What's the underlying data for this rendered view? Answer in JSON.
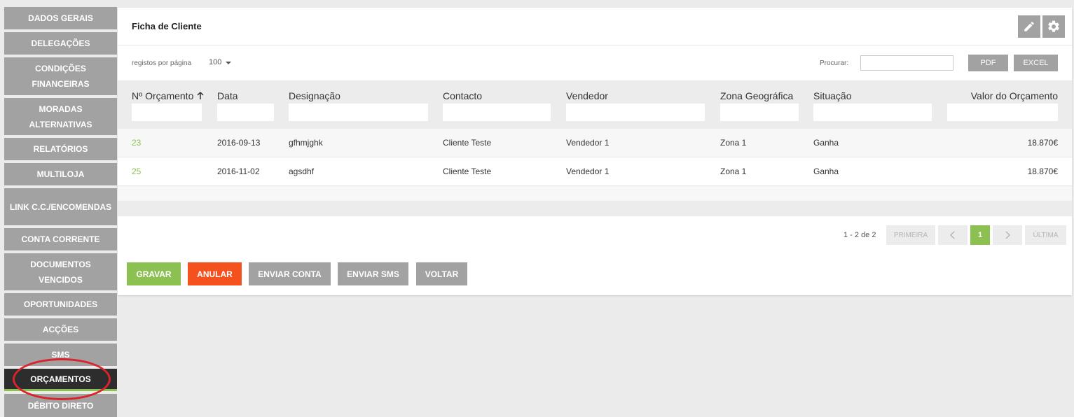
{
  "sidebar": {
    "items": [
      {
        "label": "DADOS GERAIS"
      },
      {
        "label": "DELEGAÇÕES"
      },
      {
        "label": "CONDIÇÕES FINANCEIRAS"
      },
      {
        "label": "MORADAS ALTERNATIVAS"
      },
      {
        "label": "RELATÓRIOS"
      },
      {
        "label": "MULTILOJA"
      },
      {
        "label": "LINK C.C./ENCOMENDAS"
      },
      {
        "label": "CONTA CORRENTE"
      },
      {
        "label": "DOCUMENTOS VENCIDOS"
      },
      {
        "label": "OPORTUNIDADES"
      },
      {
        "label": "ACÇÕES"
      },
      {
        "label": "SMS"
      },
      {
        "label": "ORÇAMENTOS"
      },
      {
        "label": "DÉBITO DIRETO"
      }
    ],
    "active_index": 12
  },
  "panel": {
    "title": "Ficha de Cliente",
    "icons": {
      "edit": "pencil-icon",
      "settings": "gear-icon"
    }
  },
  "toolbar": {
    "perpage_label": "registos por página",
    "perpage_value": "100",
    "search_label": "Procurar:",
    "search_value": "",
    "pdf_label": "PDF",
    "excel_label": "EXCEL"
  },
  "table": {
    "columns": [
      {
        "label": "Nº Orçamento",
        "sort": "ascending"
      },
      {
        "label": "Data"
      },
      {
        "label": "Designação"
      },
      {
        "label": "Contacto"
      },
      {
        "label": "Vendedor"
      },
      {
        "label": "Zona Geográfica"
      },
      {
        "label": "Situação"
      },
      {
        "label": "Valor do Orçamento"
      }
    ],
    "rows": [
      [
        "23",
        "2016-09-13",
        "gfhmjghk",
        "Cliente Teste",
        "Vendedor 1",
        "Zona 1",
        "Ganha",
        "18.870€"
      ],
      [
        "25",
        "2016-11-02",
        "agsdhf",
        "Cliente Teste",
        "Vendedor 1",
        "Zona 1",
        "Ganha",
        "18.870€"
      ]
    ]
  },
  "pagination": {
    "info": "1 - 2 de 2",
    "first_label": "PRIMEIRA",
    "prev_icon": "chevron-left-icon",
    "current_page": "1",
    "next_icon": "chevron-right-icon",
    "last_label": "ÚLTIMA"
  },
  "actions": {
    "save": "GRAVAR",
    "cancel": "ANULAR",
    "send_account": "ENVIAR CONTA",
    "send_sms": "ENVIAR SMS",
    "back": "VOLTAR"
  },
  "colors": {
    "accent_green": "#8cc152",
    "cancel_orange": "#f4511e",
    "neutral_button": "#a2a2a2",
    "active_sidebar": "#2d2d2d",
    "annotation_red": "#d9232d"
  }
}
